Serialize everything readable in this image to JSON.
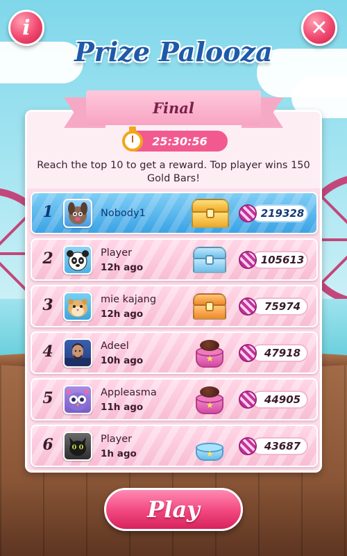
{
  "header": {
    "title": "Prize Palooza",
    "info_label": "i",
    "close_label": "✕"
  },
  "event": {
    "stage": "Final",
    "timer": "25:30:56",
    "description": "Reach the top 10 to get a reward. Top player wins 150 Gold Bars!"
  },
  "leaderboard": [
    {
      "rank": "1",
      "name": "Nobody1",
      "time": "",
      "score": "219328",
      "reward": "gold-chest",
      "avatar": "dog-avatar",
      "is_me": true
    },
    {
      "rank": "2",
      "name": "Player",
      "time": "12h ago",
      "score": "105613",
      "reward": "blue-chest",
      "avatar": "panda-avatar",
      "is_me": false
    },
    {
      "rank": "3",
      "name": "mie kajang",
      "time": "12h ago",
      "score": "75974",
      "reward": "orange-chest",
      "avatar": "hamster-avatar",
      "is_me": false
    },
    {
      "rank": "4",
      "name": "Adeel",
      "time": "10h ago",
      "score": "47918",
      "reward": "chocolate-cake",
      "avatar": "man-photo-avatar",
      "is_me": false
    },
    {
      "rank": "5",
      "name": "Appleasma",
      "time": "11h ago",
      "score": "44905",
      "reward": "chocolate-cake",
      "avatar": "owl-avatar",
      "is_me": false
    },
    {
      "rank": "6",
      "name": "Player",
      "time": "1h ago",
      "score": "43687",
      "reward": "blue-cake",
      "avatar": "cat-avatar",
      "is_me": false
    }
  ],
  "play_label": "Play",
  "colors": {
    "title": "#1f5aa8",
    "accent_pink": "#f25a8f",
    "highlight_row": "#3ba3e5",
    "row_pink": "#f8bdd3"
  }
}
